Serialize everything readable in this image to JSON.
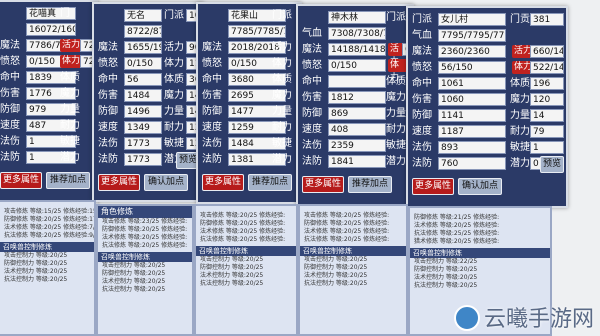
{
  "panel1": {
    "stats": [
      {
        "label": "",
        "value": "花喵真",
        "tag": "",
        "label2": "门",
        "value2": "",
        "button": ""
      },
      {
        "label": "",
        "value": "16072/16072/16072",
        "tag": "",
        "label2": "",
        "value2": "",
        "button": ""
      },
      {
        "label": "魔法",
        "value": "7786/7786",
        "tag": "活力",
        "label2": "",
        "value2": "724",
        "button": ""
      },
      {
        "label": "愤怒",
        "value": "0/150",
        "tag": "体力",
        "label2": "",
        "value2": "723",
        "button": ""
      },
      {
        "label": "命中",
        "value": "1839",
        "tag": "",
        "label2": "体质",
        "value2": "",
        "button": ""
      },
      {
        "label": "伤害",
        "value": "1776",
        "tag": "",
        "label2": "魔力",
        "value2": "",
        "button": ""
      },
      {
        "label": "防御",
        "value": "979",
        "tag": "",
        "label2": "力量",
        "value2": "",
        "button": ""
      },
      {
        "label": "速度",
        "value": "487",
        "tag": "",
        "label2": "耐力",
        "value2": "",
        "button": ""
      },
      {
        "label": "法伤",
        "value": "1",
        "tag": "",
        "label2": "敏捷",
        "value2": "",
        "button": ""
      },
      {
        "label": "法防",
        "value": "1",
        "tag": "",
        "label2": "潜力",
        "value2": "",
        "button": ""
      }
    ],
    "more_button": "更多属性",
    "recommend_button": "推荐加点"
  },
  "panel2": {
    "stats": [
      {
        "label": "",
        "value": "无名",
        "tag": "",
        "label2": "门派",
        "value2": "108",
        "button": ""
      },
      {
        "label": "",
        "value": "8722/8722/8722",
        "tag": "",
        "label2": "",
        "value2": "",
        "button": ""
      },
      {
        "label": "魔法",
        "value": "1655/1900",
        "tag": "",
        "label2": "活力",
        "value2": "900/1493",
        "button": ""
      },
      {
        "label": "愤怒",
        "value": "0/150",
        "tag": "",
        "label2": "体力",
        "value2": "1134/1485",
        "button": ""
      },
      {
        "label": "命中",
        "value": "56",
        "tag": "",
        "label2": "体质",
        "value2": "3680",
        "button": ""
      },
      {
        "label": "伤害",
        "value": "1484",
        "tag": "",
        "label2": "魔力",
        "value2": "14",
        "button": ""
      },
      {
        "label": "防御",
        "value": "1496",
        "tag": "",
        "label2": "力量",
        "value2": "14",
        "button": ""
      },
      {
        "label": "速度",
        "value": "1349",
        "tag": "",
        "label2": "耐力",
        "value2": "13",
        "button": ""
      },
      {
        "label": "法伤",
        "value": "1773",
        "tag": "",
        "label2": "敏捷",
        "value2": "13",
        "button": ""
      },
      {
        "label": "法防",
        "value": "1773",
        "tag": "",
        "label2": "潜力",
        "value2": "0",
        "button": "预览"
      }
    ],
    "more_button": "更多属性",
    "confirm_button": "确认加点"
  },
  "panel3": {
    "stats": [
      {
        "label": "",
        "value": "花果山",
        "tag": "",
        "label2": "门派",
        "value2": "",
        "button": ""
      },
      {
        "label": "",
        "value": "7785/7785/7785",
        "tag": "",
        "label2": "",
        "value2": "",
        "button": ""
      },
      {
        "label": "魔法",
        "value": "2018/2018",
        "tag": "",
        "label2": "活力",
        "value2": "",
        "button": ""
      },
      {
        "label": "愤怒",
        "value": "0/150",
        "tag": "",
        "label2": "体力",
        "value2": "",
        "button": ""
      },
      {
        "label": "命中",
        "value": "3680",
        "tag": "",
        "label2": "体质",
        "value2": "",
        "button": ""
      },
      {
        "label": "伤害",
        "value": "2695",
        "tag": "",
        "label2": "魔力",
        "value2": "",
        "button": ""
      },
      {
        "label": "防御",
        "value": "1477",
        "tag": "",
        "label2": "力量",
        "value2": "",
        "button": ""
      },
      {
        "label": "速度",
        "value": "1259",
        "tag": "",
        "label2": "耐力",
        "value2": "",
        "button": ""
      },
      {
        "label": "法伤",
        "value": "1484",
        "tag": "",
        "label2": "敏捷",
        "value2": "",
        "button": ""
      },
      {
        "label": "法防",
        "value": "1381",
        "tag": "",
        "label2": "潜力",
        "value2": "",
        "button": ""
      }
    ],
    "more_button": "更多属性",
    "recommend_button": "推荐加点"
  },
  "panel4": {
    "stats": [
      {
        "label": "",
        "value": "神木林",
        "tag": "",
        "label2": "门派",
        "value2": "",
        "button": ""
      },
      {
        "label": "气血",
        "value": "7308/7308/7308",
        "tag": "",
        "label2": "",
        "value2": "",
        "button": ""
      },
      {
        "label": "魔法",
        "value": "14188/14188",
        "tag": "活力",
        "label2": "",
        "value2": "647",
        "button": ""
      },
      {
        "label": "愤怒",
        "value": "0/150",
        "tag": "体力",
        "label2": "",
        "value2": "",
        "button": ""
      },
      {
        "label": "命中",
        "value": "",
        "tag": "",
        "label2": "体质",
        "value2": "",
        "button": ""
      },
      {
        "label": "伤害",
        "value": "1812",
        "tag": "",
        "label2": "魔力",
        "value2": "",
        "button": ""
      },
      {
        "label": "防御",
        "value": "869",
        "tag": "",
        "label2": "力量",
        "value2": "",
        "button": ""
      },
      {
        "label": "速度",
        "value": "408",
        "tag": "",
        "label2": "耐力",
        "value2": "",
        "button": ""
      },
      {
        "label": "法伤",
        "value": "2359",
        "tag": "",
        "label2": "敏捷",
        "value2": "",
        "button": ""
      },
      {
        "label": "法防",
        "value": "1841",
        "tag": "",
        "label2": "潜力",
        "value2": "",
        "button": ""
      }
    ],
    "more_button": "更多属性",
    "recommend_button": "推荐加点"
  },
  "panel5": {
    "stats": [
      {
        "label": "门派",
        "value": "女儿村",
        "tag": "",
        "label2": "门贡",
        "value2": "381",
        "button": ""
      },
      {
        "label": "气血",
        "value": "7795/7795/7795",
        "tag": "",
        "label2": "",
        "value2": "",
        "button": ""
      },
      {
        "label": "魔法",
        "value": "2360/2360",
        "tag": "活力",
        "label2": "",
        "value2": "660/1485",
        "button": ""
      },
      {
        "label": "愤怒",
        "value": "56/150",
        "tag": "体力",
        "label2": "",
        "value2": "522/1485",
        "button": ""
      },
      {
        "label": "命中",
        "value": "1061",
        "tag": "",
        "label2": "体质",
        "value2": "196",
        "button": ""
      },
      {
        "label": "伤害",
        "value": "1060",
        "tag": "",
        "label2": "魔力",
        "value2": "120",
        "button": ""
      },
      {
        "label": "防御",
        "value": "1141",
        "tag": "",
        "label2": "力量",
        "value2": "14",
        "button": ""
      },
      {
        "label": "速度",
        "value": "1187",
        "tag": "",
        "label2": "耐力",
        "value2": "79",
        "button": ""
      },
      {
        "label": "法伤",
        "value": "893",
        "tag": "",
        "label2": "敏捷",
        "value2": "1",
        "button": ""
      },
      {
        "label": "法防",
        "value": "760",
        "tag": "",
        "label2": "潜力",
        "value2": "0",
        "button": "预览"
      }
    ],
    "more_button": "更多属性",
    "confirm_button": "确认加点"
  },
  "skills": {
    "s1": {
      "header": "",
      "lines": [
        "攻击修炼 等级:15/25 修炼经验:1503/2416",
        "防御修炼 等级:20/25 修炼经验:17/3500",
        "法术修炼 等级:20/25 修炼经验:7/3500",
        "抗法修炼 等级:20/25 修炼经验:9/3500"
      ],
      "sub": "召唤兽控制修炼",
      "sublines": [
        "攻击控制力 等级:20/25",
        "防御控制力 等级:20/25",
        "法术控制力 等级:20/25",
        "抗法控制力 等级:20/25"
      ]
    },
    "s2": {
      "header": "角色修炼",
      "lines": [
        "攻击修炼 等级:23/25 修炼经验:",
        "防御修炼 等级:20/25 修炼经验:",
        "法术修炼 等级:20/25 修炼经验:",
        "抗法修炼 等级:20/25 修炼经验:"
      ],
      "sub": "召唤兽控制修炼",
      "sublines": [
        "攻击控制力 等级:20/25",
        "防御控制力 等级:20/25",
        "法术控制力 等级:20/25",
        "抗法控制力 等级:20/25"
      ]
    },
    "s3": {
      "header": "",
      "lines": [
        "攻击修炼 等级:20/25 修炼经验:",
        "防御修炼 等级:20/25 修炼经验:",
        "法术修炼 等级:20/25 修炼经验:",
        "抗法修炼 等级:20/25 修炼经验:"
      ],
      "sub": "召唤兽控制修炼",
      "sublines": [
        "攻击控制力 等级:20/25",
        "防御控制力 等级:20/25",
        "法术控制力 等级:20/25",
        "抗法控制力 等级:20/25"
      ]
    },
    "s4": {
      "header": "",
      "lines": [
        "攻击修炼 等级:20/25 修炼经验:",
        "防御修炼 等级:20/25 修炼经验:",
        "法术修炼 等级:20/25 修炼经验:",
        "抗法修炼 等级:20/25 修炼经验:"
      ],
      "sub": "召唤兽控制修炼",
      "sublines": [
        "攻击控制力 等级:20/25",
        "防御控制力 等级:20/25",
        "法术控制力 等级:20/25",
        "抗法控制力 等级:20/25"
      ]
    },
    "s5": {
      "header": "",
      "lines": [
        "防御修炼 等级:21/25 修炼经验:",
        "法术修炼 等级:20/25 修炼经验:",
        "抗法修炼 等级:25/25 修炼经验:",
        "猎术修炼 等级:20/25 修炼经验:"
      ],
      "sub": "召唤兽控制修炼",
      "sublines": [
        "攻击控制力 等级:22/25",
        "防御控制力 等级:20/25",
        "法术控制力 等级:20/25",
        "抗法控制力 等级:20/25"
      ]
    }
  },
  "watermark": "云曦手游网"
}
